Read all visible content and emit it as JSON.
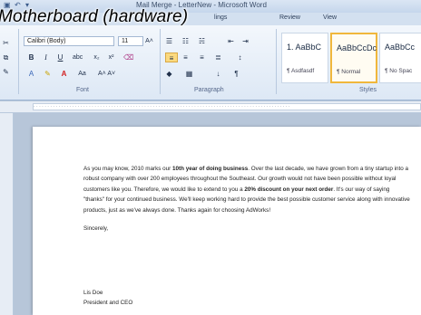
{
  "window": {
    "title": "Mail Merge - LetterNew - Microsoft Word"
  },
  "heading_overlay": "Motherboard (hardware)",
  "tabs": [
    {
      "label": "lings"
    },
    {
      "label": "Review"
    },
    {
      "label": "View"
    }
  ],
  "font": {
    "family": "Calibri (Body)",
    "size": "11",
    "group_label": "Font"
  },
  "paragraph": {
    "group_label": "Paragraph"
  },
  "styles": {
    "group_label": "Styles",
    "items": [
      {
        "sample": "1. AaBbC",
        "name": "¶ Asdfasdf"
      },
      {
        "sample": "AaBbCcDc",
        "name": "¶ Normal"
      },
      {
        "sample": "AaBbCc",
        "name": "¶ No Spac"
      }
    ]
  },
  "document": {
    "paragraph_parts": [
      {
        "text": "As you may know, 2010 marks our ",
        "bold": false
      },
      {
        "text": "10th year of doing business",
        "bold": true
      },
      {
        "text": ". Over the last decade, we have grown from a tiny startup into a robust company with over 200 employees throughout the Southeast. Our growth would not have been possible without loyal customers like you. Therefore, we would like to extend to you a ",
        "bold": false
      },
      {
        "text": "20% discount on your next order",
        "bold": true
      },
      {
        "text": ". It's our way of saying \"thanks\" for your continued business. We'll keep working hard to provide the best possible customer service along with innovative products, just as we've always done. Thanks again for choosing AdWorks!",
        "bold": false
      }
    ],
    "closing": "Sincerely,",
    "signer_name": "Lis Doe",
    "signer_title": "President and CEO"
  },
  "colors": {
    "ribbon_bg": "#dde8f5",
    "active_style_border": "#f0b73c",
    "workspace_bg": "#b7c6d9"
  }
}
